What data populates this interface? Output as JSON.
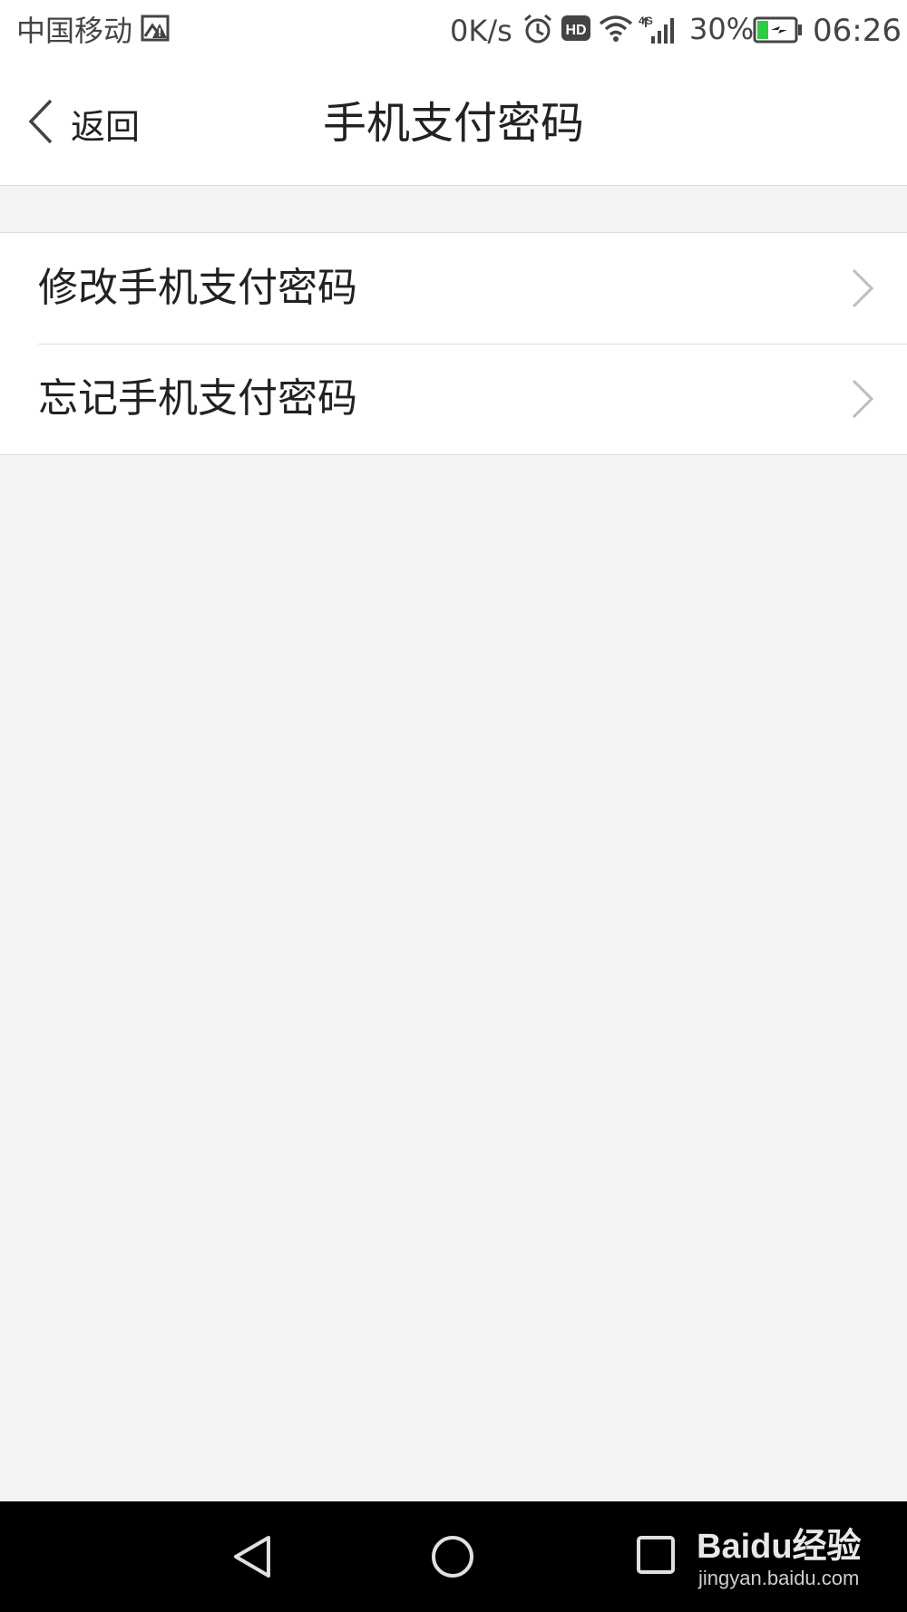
{
  "status_bar": {
    "carrier": "中国移动",
    "net_speed": "0K/s",
    "battery_percent": "30%",
    "battery_level": 0.3,
    "time": "06:26",
    "signal_label": "4G",
    "hd_label": "HD",
    "icons": [
      "gallery-alert-icon",
      "alarm-icon",
      "hd-icon",
      "wifi-icon",
      "signal-icon",
      "battery-charging-icon"
    ],
    "battery_color": "#2ecc40"
  },
  "header": {
    "back_label": "返回",
    "title": "手机支付密码"
  },
  "menu": {
    "items": [
      {
        "label": "修改手机支付密码"
      },
      {
        "label": "忘记手机支付密码"
      }
    ]
  },
  "nav_bar": {
    "buttons": [
      "back-triangle-icon",
      "home-circle-icon",
      "recents-square-icon"
    ]
  },
  "watermark": {
    "text": "Baidu经验",
    "url": "jingyan.baidu.com"
  }
}
